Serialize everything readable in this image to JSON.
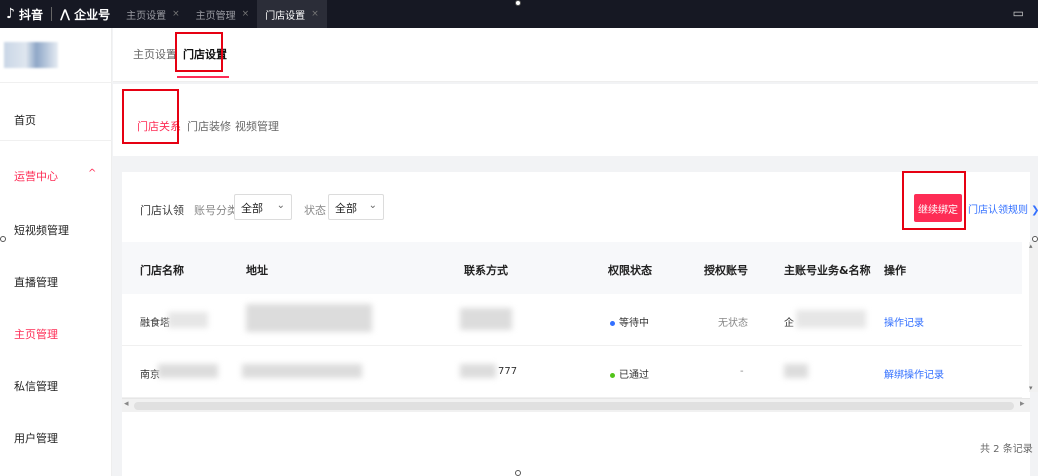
{
  "topbar": {
    "brand_tiktok": "抖音",
    "brand_enterprise": "企业号",
    "tabs": [
      {
        "label": "主页设置",
        "close": "×"
      },
      {
        "label": "主页管理",
        "close": "×"
      },
      {
        "label": "门店设置",
        "close": "×"
      }
    ]
  },
  "sidebar": {
    "items": [
      {
        "label": "首页"
      },
      {
        "label": "运营中心"
      },
      {
        "label": "短视频管理"
      },
      {
        "label": "直播管理"
      },
      {
        "label": "主页管理"
      },
      {
        "label": "私信管理"
      },
      {
        "label": "用户管理"
      }
    ],
    "expand_glyph": "^"
  },
  "subnav": {
    "tabs": [
      {
        "label": "主页设置"
      },
      {
        "label": "门店设置"
      }
    ]
  },
  "inner_tabs": [
    {
      "label": "门店关系"
    },
    {
      "label": "门店装修"
    },
    {
      "label": "视频管理"
    }
  ],
  "filters": {
    "store_auth_label": "门店认领",
    "account_type_label": "账号分类",
    "account_type_value": "全部",
    "status_label": "状态",
    "status_value": "全部",
    "bind_button": "继续绑定",
    "rules_link": "门店认领规则 ❯"
  },
  "table": {
    "columns": [
      "门店名称",
      "地址",
      "联系方式",
      "权限状态",
      "授权账号",
      "主账号业务&名称",
      "操作"
    ],
    "rows": [
      {
        "name": "融食塔",
        "address": "",
        "contact": "",
        "permission_status": "等待中",
        "status_color": "#3370ff",
        "auth_account": "无状态",
        "main_account": "企",
        "actions": [
          "操作记录"
        ]
      },
      {
        "name": "南京",
        "address": "",
        "contact": "777",
        "permission_status": "已通过",
        "status_color": "#52c41a",
        "auth_account": "-",
        "main_account": "",
        "actions": [
          "解绑",
          "操作记录"
        ]
      }
    ],
    "total": "共 2 条记录"
  }
}
